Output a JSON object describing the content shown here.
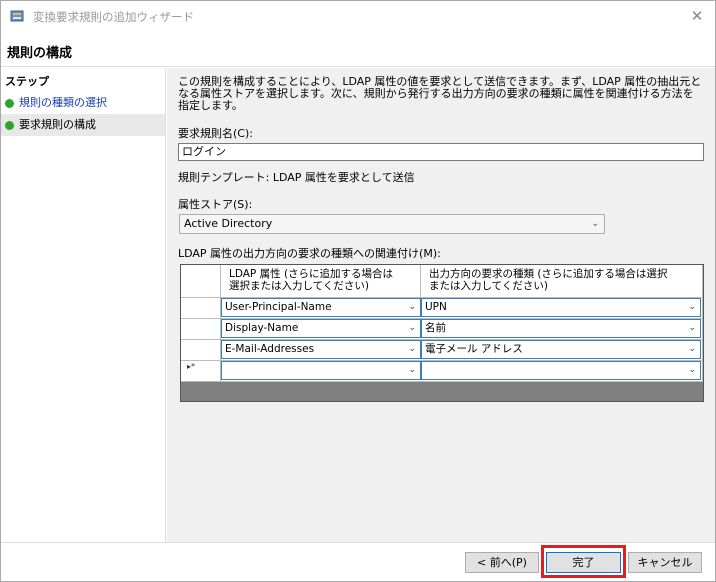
{
  "window": {
    "title": "変換要求規則の追加ウィザード",
    "close_glyph": "✕"
  },
  "header": {
    "title": "規則の構成"
  },
  "sidebar": {
    "title": "ステップ",
    "steps": [
      {
        "label": "規則の種類の選択",
        "status": "completed"
      },
      {
        "label": "要求規則の構成",
        "status": "current"
      }
    ]
  },
  "main": {
    "description": "この規則を構成することにより、LDAP 属性の値を要求として送信できます。まず、LDAP 属性の抽出元となる属性ストアを選択します。次に、規則から発行する出力方向の要求の種類に属性を関連付ける方法を指定します。",
    "rule_name_label": "要求規則名(C):",
    "rule_name_value": "ログイン",
    "template_label": "規則テンプレート: LDAP 属性を要求として送信",
    "store_label": "属性ストア(S):",
    "store_value": "Active Directory",
    "mapping_label": "LDAP 属性の出力方向の要求の種類への関連付け(M):",
    "grid": {
      "col1_header_line1": "LDAP 属性 (さらに追加する場合は",
      "col1_header_line2": "選択または入力してください)",
      "col2_header_line1": "出力方向の要求の種類 (さらに追加する場合は選択",
      "col2_header_line2": "または入力してください)",
      "rows": [
        {
          "ldap": "User-Principal-Name",
          "claim": "UPN"
        },
        {
          "ldap": "Display-Name",
          "claim": "名前"
        },
        {
          "ldap": "E-Mail-Addresses",
          "claim": "電子メール アドレス"
        },
        {
          "ldap": "",
          "claim": ""
        }
      ],
      "new_row_marker": "▸*"
    }
  },
  "footer": {
    "back_label": "< 前へ(P)",
    "finish_label": "完了",
    "cancel_label": "キャンセル"
  },
  "colors": {
    "accent": "#0078d7",
    "highlight": "#e02020",
    "step_dot": "#2fa32f"
  }
}
